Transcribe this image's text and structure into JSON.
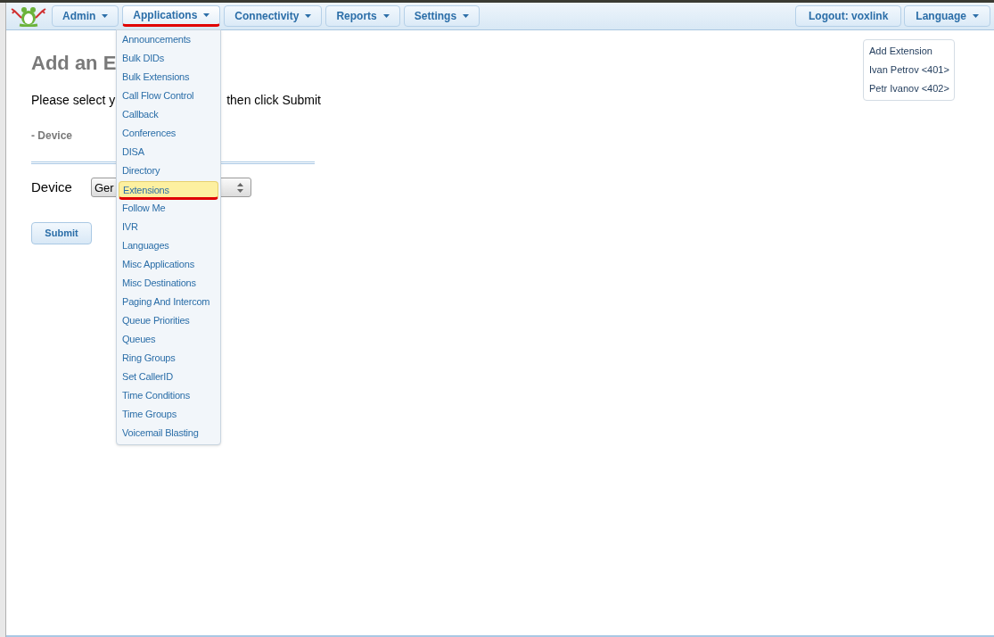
{
  "nav": [
    {
      "label": "Admin",
      "selected": false,
      "underlined": false
    },
    {
      "label": "Applications",
      "selected": true,
      "underlined": true
    },
    {
      "label": "Connectivity",
      "selected": false,
      "underlined": false
    },
    {
      "label": "Reports",
      "selected": false,
      "underlined": false
    },
    {
      "label": "Settings",
      "selected": false,
      "underlined": false
    }
  ],
  "nav_right": {
    "logout": "Logout: voxlink",
    "language": "Language"
  },
  "menu": [
    {
      "label": "Announcements",
      "selected": false,
      "underlined": false
    },
    {
      "label": "Bulk DIDs",
      "selected": false,
      "underlined": false
    },
    {
      "label": "Bulk Extensions",
      "selected": false,
      "underlined": false
    },
    {
      "label": "Call Flow Control",
      "selected": false,
      "underlined": false
    },
    {
      "label": "Callback",
      "selected": false,
      "underlined": false
    },
    {
      "label": "Conferences",
      "selected": false,
      "underlined": false
    },
    {
      "label": "DISA",
      "selected": false,
      "underlined": false
    },
    {
      "label": "Directory",
      "selected": false,
      "underlined": false
    },
    {
      "label": "Extensions",
      "selected": true,
      "underlined": true
    },
    {
      "label": "Follow Me",
      "selected": false,
      "underlined": false
    },
    {
      "label": "IVR",
      "selected": false,
      "underlined": false
    },
    {
      "label": "Languages",
      "selected": false,
      "underlined": false
    },
    {
      "label": "Misc Applications",
      "selected": false,
      "underlined": false
    },
    {
      "label": "Misc Destinations",
      "selected": false,
      "underlined": false
    },
    {
      "label": "Paging And Intercom",
      "selected": false,
      "underlined": false
    },
    {
      "label": "Queue Priorities",
      "selected": false,
      "underlined": false
    },
    {
      "label": "Queues",
      "selected": false,
      "underlined": false
    },
    {
      "label": "Ring Groups",
      "selected": false,
      "underlined": false
    },
    {
      "label": "Set CallerID",
      "selected": false,
      "underlined": false
    },
    {
      "label": "Time Conditions",
      "selected": false,
      "underlined": false
    },
    {
      "label": "Time Groups",
      "selected": false,
      "underlined": false
    },
    {
      "label": "Voicemail Blasting",
      "selected": false,
      "underlined": false
    }
  ],
  "heading": "Add an E",
  "instruction": [
    "Please select y",
    "then click Submit"
  ],
  "section": "- Device",
  "device": {
    "label": "Device",
    "value": "Ger"
  },
  "submit": "Submit",
  "side_list": [
    "Add Extension",
    "Ivan Petrov <401>",
    "Petr Ivanov <402>"
  ]
}
